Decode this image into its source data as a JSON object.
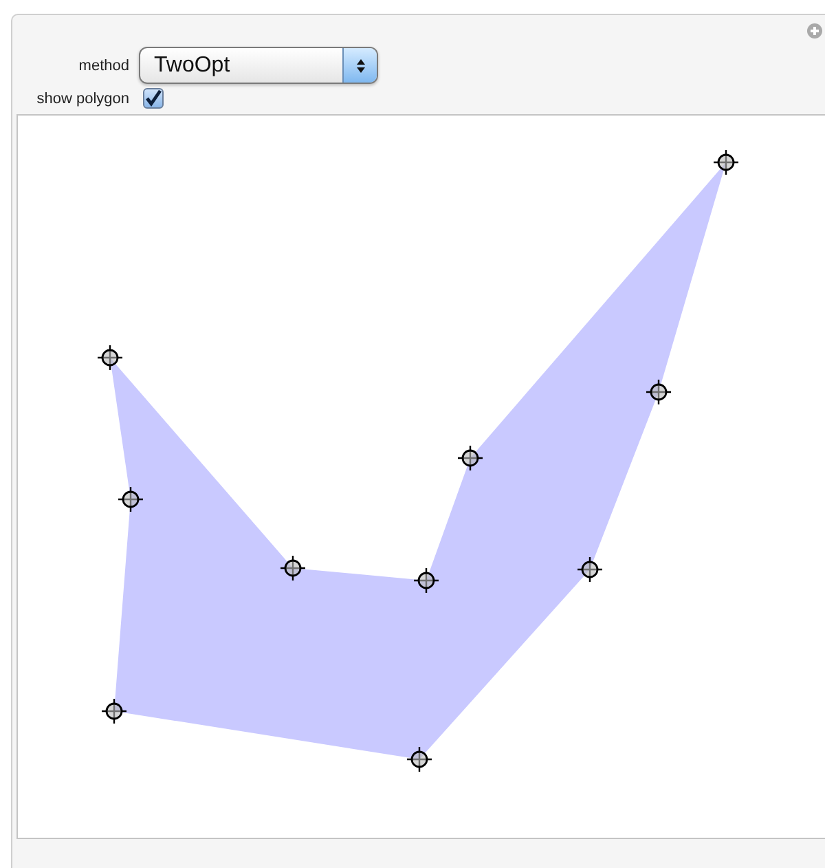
{
  "controls": {
    "method": {
      "label": "method",
      "value": "TwoOpt"
    },
    "show_polygon": {
      "label": "show polygon",
      "checked": true
    }
  }
}
